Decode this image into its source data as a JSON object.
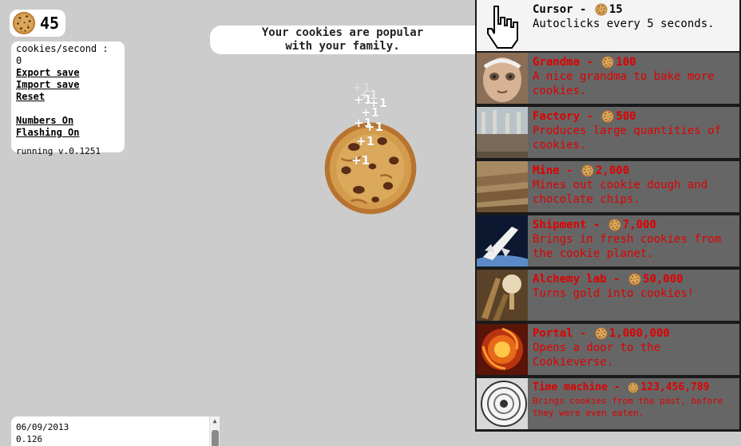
{
  "cookies": {
    "count": "45"
  },
  "menu": {
    "cps": "cookies/second : 0",
    "export": "Export save",
    "import": "Import save",
    "reset": "Reset",
    "numbers": "Numbers On",
    "flashing": "Flashing On",
    "version": "running v.0.1251"
  },
  "message": {
    "line1": "Your cookies are popular",
    "line2": "with your family."
  },
  "floaters": [
    "+1",
    "+1",
    "+1",
    "+1",
    "+1",
    "+1",
    "+1",
    "+1",
    "+1"
  ],
  "log": {
    "line1": "06/09/2013",
    "line2": "0.126"
  },
  "store": [
    {
      "name": "Cursor",
      "price": "15",
      "desc": "Autoclicks every 5 seconds.",
      "available": true
    },
    {
      "name": "Grandma",
      "price": "100",
      "desc": "A nice grandma to bake more cookies.",
      "available": false
    },
    {
      "name": "Factory",
      "price": "500",
      "desc": "Produces large quantities of cookies.",
      "available": false
    },
    {
      "name": "Mine",
      "price": "2,000",
      "desc": "Mines out cookie dough and chocolate chips.",
      "available": false
    },
    {
      "name": "Shipment",
      "price": "7,000",
      "desc": "Brings in fresh cookies from the cookie planet.",
      "available": false
    },
    {
      "name": "Alchemy lab",
      "price": "50,000",
      "desc": "Turns gold into cookies!",
      "available": false
    },
    {
      "name": "Portal",
      "price": "1,000,000",
      "desc": "Opens a door to the Cookieverse.",
      "available": false
    },
    {
      "name": "Time machine",
      "price": "123,456,789",
      "desc": "Brings cookies from the past, before they were even eaten.",
      "available": false
    }
  ],
  "icons": {
    "cookie": "cookie-icon",
    "cursor": "hand-cursor-icon",
    "grandma": "grandma-portrait-icon",
    "factory": "factory-icon",
    "mine": "mine-icon",
    "shipment": "shuttle-icon",
    "alchemy": "alchemy-icon",
    "portal": "portal-icon",
    "timemachine": "clock-spiral-icon"
  },
  "colors": {
    "background": "#cccccc",
    "locked_text": "#e00000",
    "locked_bg": "#666666",
    "available_bg": "#f4f4f4"
  }
}
